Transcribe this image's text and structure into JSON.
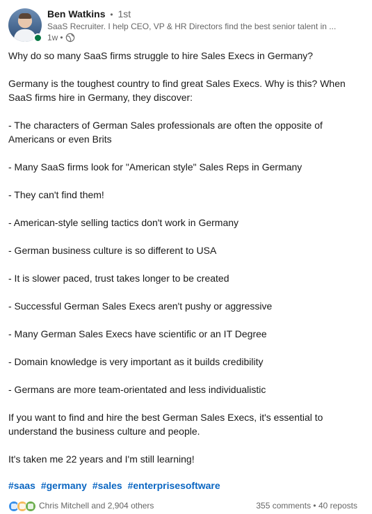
{
  "author": {
    "name": "Ben Watkins",
    "degree": "1st",
    "headline": "SaaS Recruiter. I help CEO, VP & HR Directors find the best senior talent in ...",
    "time": "1w",
    "separator": "•"
  },
  "post": {
    "paragraphs": [
      "Why do so many SaaS firms struggle to hire Sales Execs in Germany?",
      "Germany is the toughest country to find great Sales Execs. Why is this? When SaaS firms hire in Germany, they discover:",
      "- The characters of German Sales professionals are often the opposite of Americans or even Brits",
      "- Many SaaS firms look for \"American style\" Sales Reps in Germany",
      "- They can't find them!",
      "- American-style selling tactics don't work in Germany",
      "- German business culture is so different to USA",
      "- It is slower paced, trust takes longer to be created",
      "- Successful German Sales Execs aren't pushy or aggressive",
      "- Many German Sales Execs have scientific or an IT Degree",
      "- Domain knowledge is very important as it builds credibility",
      "- Germans are more team-orientated and less individualistic",
      "If you want to find and hire the best German Sales Execs, it's essential to understand the business culture and people.",
      "It's taken me 22 years and I'm still learning!"
    ],
    "hashtags": [
      "#saas",
      "#germany",
      "#sales",
      "#enterprisesoftware"
    ]
  },
  "social": {
    "reactors": "Chris Mitchell and 2,904 others",
    "comments": "355 comments",
    "reposts": "40 reposts",
    "separator": "•"
  },
  "colors": {
    "link": "#0a66c2",
    "presence": "#057642",
    "muted": "#666666"
  }
}
